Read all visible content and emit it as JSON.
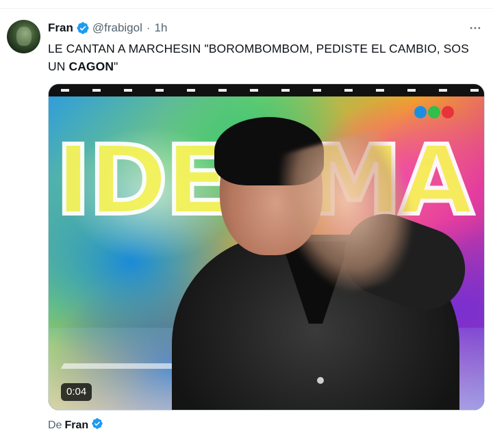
{
  "tweet": {
    "author_name": "Fran",
    "handle": "@frabigol",
    "separator": "·",
    "time": "1h",
    "text_before_bold": "LE CANTAN A MARCHESIN \"BOROMBOMBOM, PEDISTE EL CAMBIO, SOS UN ",
    "text_bold": "CAGON",
    "text_after_bold": "\"",
    "media": {
      "duration": "0:04",
      "show_letters": "IDEOMA"
    },
    "attribution_prefix": "De",
    "attribution_name": "Fran"
  },
  "colors": {
    "verified_blue": "#1d9bf0",
    "secondary_text": "#536471",
    "primary_text": "#0f1419",
    "channel_logo": [
      "#1a8fe0",
      "#2fbf4a",
      "#e8333a"
    ]
  },
  "icons": {
    "verified": "verified-badge-icon",
    "more": "more-options-icon"
  }
}
